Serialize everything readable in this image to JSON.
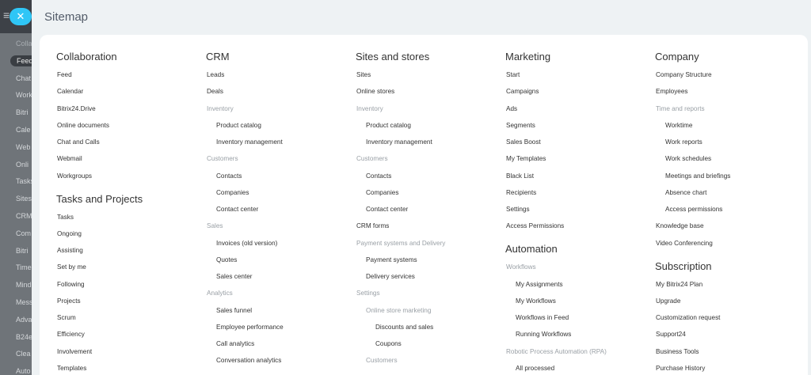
{
  "background": {
    "sidebar_items": [
      {
        "label": "Colla",
        "faded": true
      },
      {
        "label": "Feed",
        "pill": true
      },
      {
        "label": "Chat"
      },
      {
        "label": "Work"
      },
      {
        "label": "Bitri"
      },
      {
        "label": "Cale"
      },
      {
        "label": "Web"
      },
      {
        "label": "Onli"
      },
      {
        "label": "Tasks"
      },
      {
        "label": "Sites"
      },
      {
        "label": "CRM"
      },
      {
        "label": "Com"
      },
      {
        "label": "Bitri"
      },
      {
        "label": "Time"
      },
      {
        "label": "Mind"
      },
      {
        "label": "Mess"
      },
      {
        "label": "Adva"
      },
      {
        "label": "B24e"
      },
      {
        "label": "Clea"
      },
      {
        "label": "Auto"
      }
    ]
  },
  "close_button": {
    "icon": "close-icon",
    "glyph": "✕"
  },
  "menu_icon": {
    "glyph": "≡"
  },
  "sitemap": {
    "title": "Sitemap",
    "columns": [
      {
        "sections": [
          {
            "title": "Collaboration",
            "items": [
              {
                "label": "Feed",
                "level": 0
              },
              {
                "label": "Calendar",
                "level": 0
              },
              {
                "label": "Bitrix24.Drive",
                "level": 0
              },
              {
                "label": "Online documents",
                "level": 0
              },
              {
                "label": "Chat and Calls",
                "level": 0
              },
              {
                "label": "Webmail",
                "level": 0
              },
              {
                "label": "Workgroups",
                "level": 0
              }
            ]
          },
          {
            "title": "Tasks and Projects",
            "items": [
              {
                "label": "Tasks",
                "level": 0
              },
              {
                "label": "Ongoing",
                "level": 0
              },
              {
                "label": "Assisting",
                "level": 0
              },
              {
                "label": "Set by me",
                "level": 0
              },
              {
                "label": "Following",
                "level": 0
              },
              {
                "label": "Projects",
                "level": 0
              },
              {
                "label": "Scrum",
                "level": 0
              },
              {
                "label": "Efficiency",
                "level": 0
              },
              {
                "label": "Involvement",
                "level": 0
              },
              {
                "label": "Templates",
                "level": 0
              }
            ]
          }
        ]
      },
      {
        "sections": [
          {
            "title": "CRM",
            "items": [
              {
                "label": "Leads",
                "level": 0
              },
              {
                "label": "Deals",
                "level": 0
              },
              {
                "label": "Inventory",
                "level": 0,
                "group": true
              },
              {
                "label": "Product catalog",
                "level": 1
              },
              {
                "label": "Inventory management",
                "level": 1
              },
              {
                "label": "Customers",
                "level": 0,
                "group": true
              },
              {
                "label": "Contacts",
                "level": 1
              },
              {
                "label": "Companies",
                "level": 1
              },
              {
                "label": "Contact center",
                "level": 1
              },
              {
                "label": "Sales",
                "level": 0,
                "group": true
              },
              {
                "label": "Invoices (old version)",
                "level": 1
              },
              {
                "label": "Quotes",
                "level": 1
              },
              {
                "label": "Sales center",
                "level": 1
              },
              {
                "label": "Analytics",
                "level": 0,
                "group": true
              },
              {
                "label": "Sales funnel",
                "level": 1
              },
              {
                "label": "Employee performance",
                "level": 1
              },
              {
                "label": "Call analytics",
                "level": 1
              },
              {
                "label": "Conversation analytics",
                "level": 1
              }
            ]
          }
        ]
      },
      {
        "sections": [
          {
            "title": "Sites and stores",
            "items": [
              {
                "label": "Sites",
                "level": 0
              },
              {
                "label": "Online stores",
                "level": 0
              },
              {
                "label": "Inventory",
                "level": 0,
                "group": true
              },
              {
                "label": "Product catalog",
                "level": 1
              },
              {
                "label": "Inventory management",
                "level": 1
              },
              {
                "label": "Customers",
                "level": 0,
                "group": true
              },
              {
                "label": "Contacts",
                "level": 1
              },
              {
                "label": "Companies",
                "level": 1
              },
              {
                "label": "Contact center",
                "level": 1
              },
              {
                "label": "CRM forms",
                "level": 0
              },
              {
                "label": "Payment systems and Delivery",
                "level": 0,
                "group": true
              },
              {
                "label": "Payment systems",
                "level": 1
              },
              {
                "label": "Delivery services",
                "level": 1
              },
              {
                "label": "Settings",
                "level": 0,
                "group": true
              },
              {
                "label": "Online store marketing",
                "level": 1,
                "group": true
              },
              {
                "label": "Discounts and sales",
                "level": 2
              },
              {
                "label": "Coupons",
                "level": 2
              },
              {
                "label": "Customers",
                "level": 1,
                "group": true
              }
            ]
          }
        ]
      },
      {
        "sections": [
          {
            "title": "Marketing",
            "items": [
              {
                "label": "Start",
                "level": 0
              },
              {
                "label": "Campaigns",
                "level": 0
              },
              {
                "label": "Ads",
                "level": 0
              },
              {
                "label": "Segments",
                "level": 0
              },
              {
                "label": "Sales Boost",
                "level": 0
              },
              {
                "label": "My Templates",
                "level": 0
              },
              {
                "label": "Black List",
                "level": 0
              },
              {
                "label": "Recipients",
                "level": 0
              },
              {
                "label": "Settings",
                "level": 0
              },
              {
                "label": "Access Permissions",
                "level": 0
              }
            ]
          },
          {
            "title": "Automation",
            "items": [
              {
                "label": "Workflows",
                "level": 0,
                "group": true
              },
              {
                "label": "My Assignments",
                "level": 1
              },
              {
                "label": "My Workflows",
                "level": 1
              },
              {
                "label": "Workflows in Feed",
                "level": 1
              },
              {
                "label": "Running Workflows",
                "level": 1
              },
              {
                "label": "Robotic Process Automation (RPA)",
                "level": 0,
                "group": true
              },
              {
                "label": "All processed",
                "level": 1
              }
            ]
          }
        ]
      },
      {
        "sections": [
          {
            "title": "Company",
            "items": [
              {
                "label": "Company Structure",
                "level": 0
              },
              {
                "label": "Employees",
                "level": 0
              },
              {
                "label": "Time and reports",
                "level": 0,
                "group": true
              },
              {
                "label": "Worktime",
                "level": 1
              },
              {
                "label": "Work reports",
                "level": 1
              },
              {
                "label": "Work schedules",
                "level": 1
              },
              {
                "label": "Meetings and briefings",
                "level": 1
              },
              {
                "label": "Absence chart",
                "level": 1
              },
              {
                "label": "Access permissions",
                "level": 1
              },
              {
                "label": "Knowledge base",
                "level": 0
              },
              {
                "label": "Video Conferencing",
                "level": 0
              }
            ]
          },
          {
            "title": "Subscription",
            "items": [
              {
                "label": "My Bitrix24 Plan",
                "level": 0
              },
              {
                "label": "Upgrade",
                "level": 0
              },
              {
                "label": "Customization request",
                "level": 0
              },
              {
                "label": "Support24",
                "level": 0
              },
              {
                "label": "Business Tools",
                "level": 0
              },
              {
                "label": "Purchase History",
                "level": 0
              }
            ]
          }
        ]
      }
    ]
  }
}
